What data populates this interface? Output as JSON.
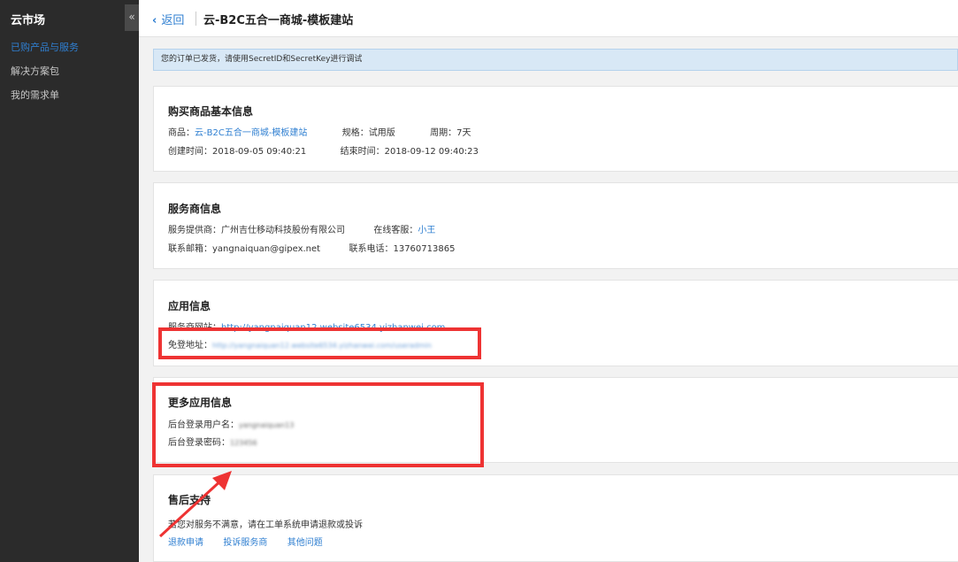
{
  "sidebar": {
    "title": "云市场",
    "collapse_glyph": "«",
    "items": [
      {
        "label": "已购产品与服务",
        "active": true
      },
      {
        "label": "解决方案包",
        "active": false
      },
      {
        "label": "我的需求单",
        "active": false
      }
    ]
  },
  "header": {
    "back_label": "返回",
    "title": "云-B2C五合一商城-模板建站"
  },
  "notice": "您的订单已发货，请使用SecretID和SecretKey进行调试",
  "basic": {
    "heading": "购买商品基本信息",
    "product_label": "商品：",
    "product_value": "云-B2C五合一商城-模板建站",
    "spec_label": "规格：",
    "spec_value": "试用版",
    "period_label": "周期：",
    "period_value": "7天",
    "created_label": "创建时间：",
    "created_value": "2018-09-05 09:40:21",
    "end_label": "结束时间：",
    "end_value": "2018-09-12 09:40:23"
  },
  "provider": {
    "heading": "服务商信息",
    "provider_label": "服务提供商：",
    "provider_value": "广州吉仕移动科技股份有限公司",
    "cs_label": "在线客服：",
    "cs_value": "小王",
    "email_label": "联系邮箱：",
    "email_value": "yangnaiquan@gipex.net",
    "phone_label": "联系电话：",
    "phone_value": "13760713865"
  },
  "app": {
    "heading": "应用信息",
    "site_label": "服务商网站：",
    "site_value": "http://yangnaiquan12.website6534.yizhanwei.com",
    "login_label": "免登地址：",
    "login_value": "http://yangnaiquan12.website6534.yizhanwei.com/useradmin"
  },
  "more": {
    "heading": "更多应用信息",
    "user_label": "后台登录用户名：",
    "user_value": "yangnaiquan13",
    "pwd_label": "后台登录密码：",
    "pwd_value": "123456"
  },
  "aftersale": {
    "heading": "售后支持",
    "desc": "若您对服务不满意，请在工单系统申请退款或投诉",
    "links": [
      "退款申请",
      "投诉服务商",
      "其他问题"
    ]
  },
  "annotation_color": "#ee3333",
  "accent": "#2f7fd1"
}
